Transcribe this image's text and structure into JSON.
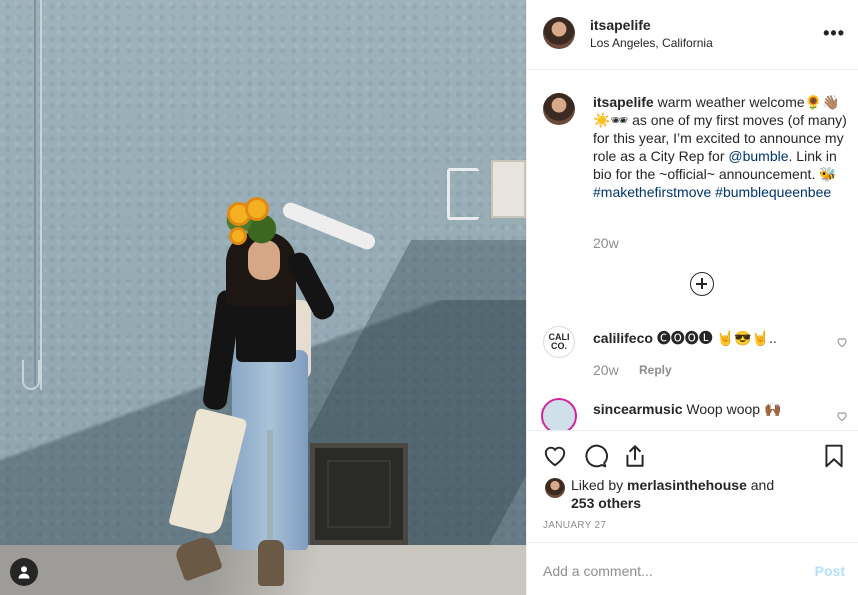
{
  "photo": {
    "description_icon": "person-tag-icon"
  },
  "header": {
    "username": "itsapelife",
    "location": "Los Angeles, California",
    "more_icon": "•••"
  },
  "caption": {
    "username": "itsapelife",
    "text_part1": "warm weather welcome🌻👋🏽☀️🕶 as one of my first moves (of many) for this year, I’m excited to announce my role as a City Rep for ",
    "mention": "@bumble",
    "text_part2": ". Link in bio for the ~official~ announcement. 🐝",
    "hashtag1": "#makethefirstmove",
    "hashtag2": "#bumblequeenbee",
    "time": "20w"
  },
  "comments": [
    {
      "avatar_text": "CALI CO.",
      "username": "calilifeco",
      "text": "🅒🅞🅞🅛 🤘😎🤘..",
      "time": "20w",
      "reply_label": "Reply"
    },
    {
      "username": "sincearmusic",
      "text": "Woop woop 🙌🏾"
    }
  ],
  "likes": {
    "prefix": "Liked by ",
    "user": "merlasinthehouse",
    "middle": " and",
    "count": "253 others"
  },
  "date": "JANUARY 27",
  "add_comment": {
    "placeholder": "Add a comment...",
    "post_label": "Post"
  },
  "colors": {
    "link": "#003569",
    "muted": "#8e8e8e",
    "post_disabled": "#b2dffc",
    "story_ring": "#d6249f"
  }
}
